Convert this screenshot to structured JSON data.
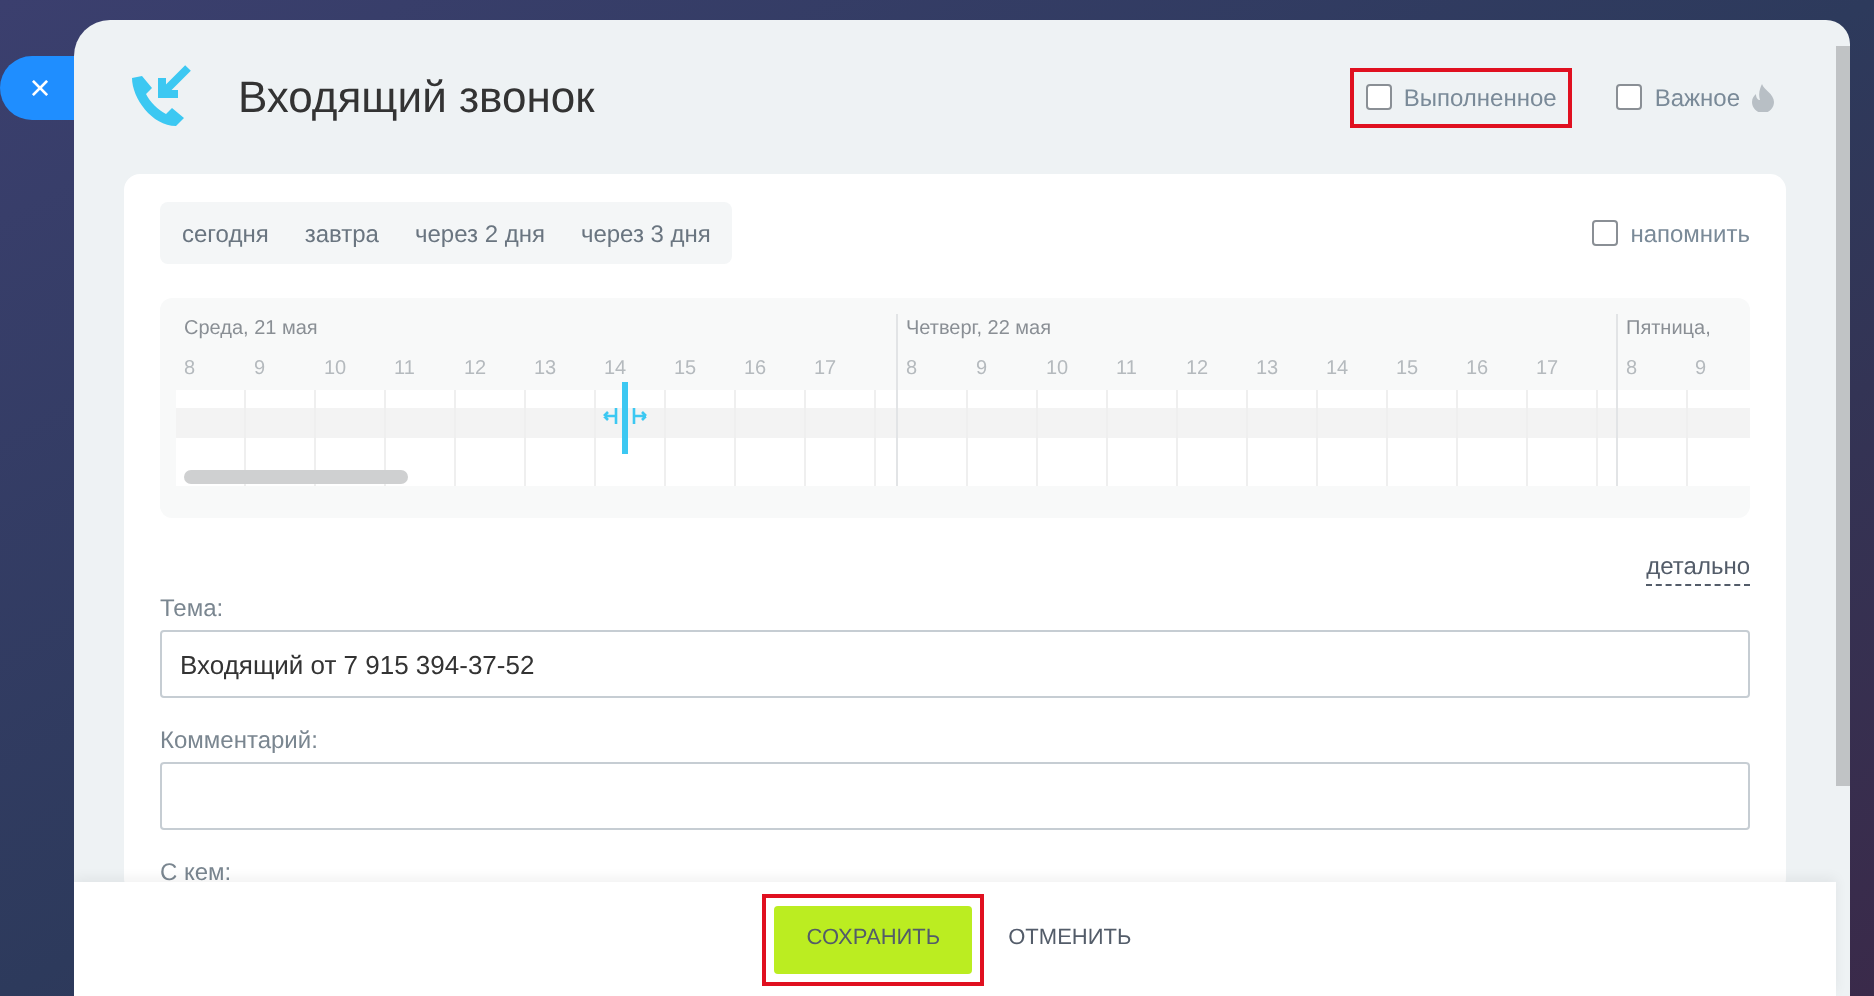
{
  "close_button": {
    "label": "×"
  },
  "header": {
    "title": "Входящий звонок",
    "flags": [
      {
        "label": "Выполненное",
        "checked": false,
        "highlighted": true,
        "icon": false
      },
      {
        "label": "Важное",
        "checked": false,
        "highlighted": false,
        "icon": true
      }
    ]
  },
  "quick_dates": [
    {
      "label": "сегодня"
    },
    {
      "label": "завтра"
    },
    {
      "label": "через 2 дня"
    },
    {
      "label": "через 3 дня"
    }
  ],
  "remind": {
    "label": "напомнить",
    "checked": false
  },
  "timeline": {
    "days": [
      {
        "label": "Среда, 21 мая",
        "hours": [
          "8",
          "9",
          "10",
          "11",
          "12",
          "13",
          "14",
          "15",
          "16",
          "17"
        ],
        "has_cursor": true
      },
      {
        "label": "Четверг, 22 мая",
        "hours": [
          "8",
          "9",
          "10",
          "11",
          "12",
          "13",
          "14",
          "15",
          "16",
          "17"
        ],
        "has_cursor": false
      },
      {
        "label": "Пятница,",
        "hours": [
          "8",
          "9"
        ],
        "has_cursor": false
      }
    ]
  },
  "details_link": "детально",
  "fields": [
    {
      "kind": "input",
      "label": "Тема:",
      "value": "Входящий от 7 915 394-37-52"
    },
    {
      "kind": "input",
      "label": "Комментарий:"
    },
    {
      "kind": "label",
      "label": "С кем:"
    }
  ],
  "footer": {
    "save": {
      "label": "СОХРАНИТЬ",
      "highlighted": true
    },
    "cancel": {
      "label": "ОТМЕНИТЬ"
    }
  }
}
